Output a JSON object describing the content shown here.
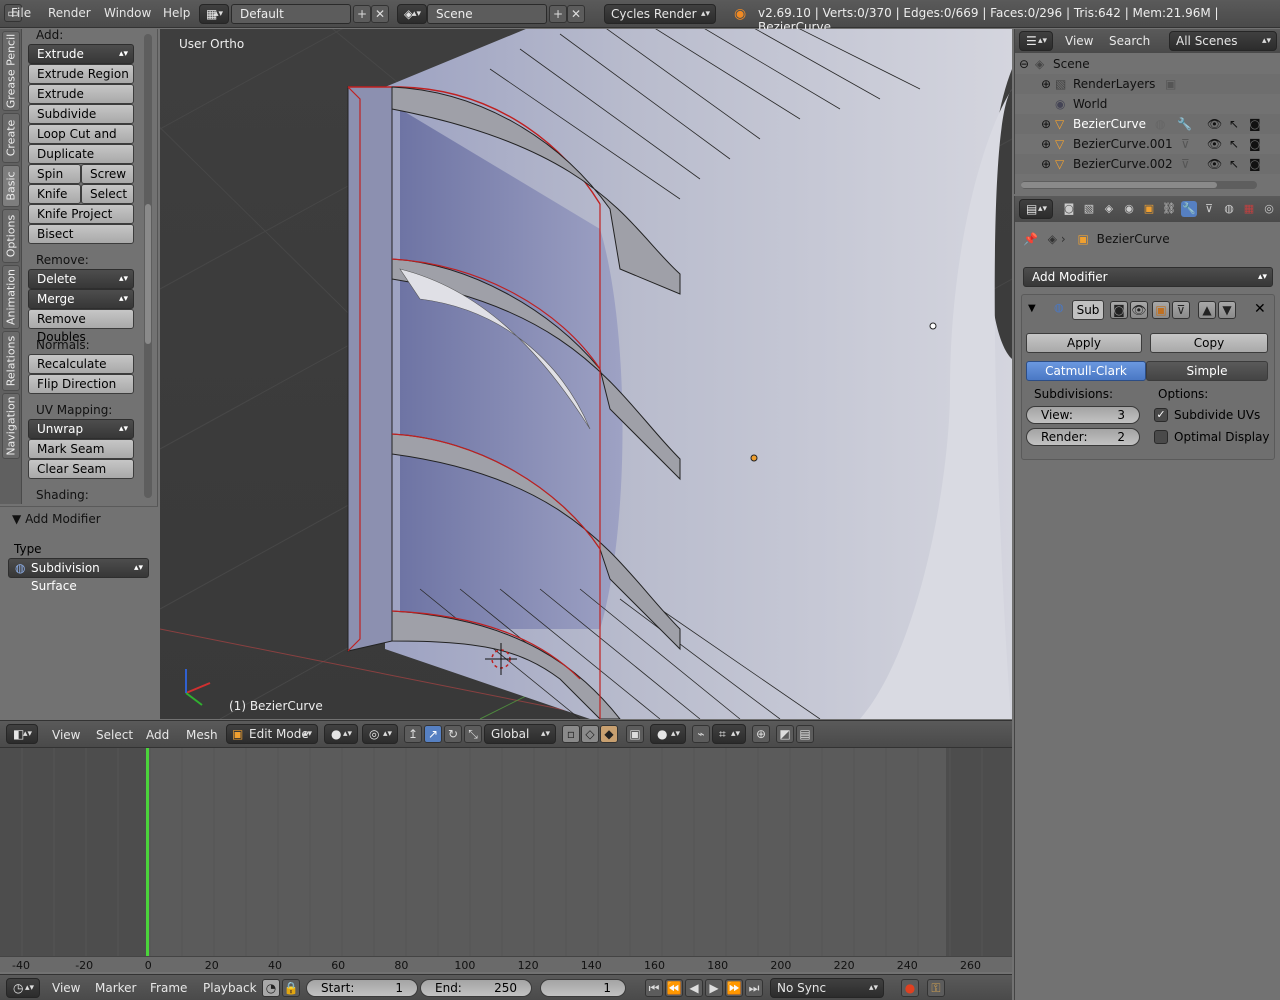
{
  "topbar": {
    "menus": [
      "File",
      "Render",
      "Window",
      "Help"
    ],
    "layout": "Default",
    "scene": "Scene",
    "engine": "Cycles Render",
    "stats": "v2.69.10 | Verts:0/370 | Edges:0/669 | Faces:0/296 | Tris:642 | Mem:21.96M | BezierCurve"
  },
  "tabs": [
    "Grease Pencil",
    "Create",
    "Basic",
    "Options",
    "Animation",
    "Relations",
    "Navigation"
  ],
  "toolshelf": {
    "add_label": "Add:",
    "extrude": "Extrude",
    "extrude_region": "Extrude Region",
    "extrude_individual": "Extrude Individual",
    "subdivide": "Subdivide",
    "loop_cut": "Loop Cut and Slide",
    "duplicate": "Duplicate",
    "spin": "Spin",
    "screw": "Screw",
    "knife": "Knife",
    "select": "Select",
    "knife_project": "Knife Project",
    "bisect": "Bisect",
    "remove_label": "Remove:",
    "delete": "Delete",
    "merge": "Merge",
    "remove_doubles": "Remove Doubles",
    "normals_label": "Normals:",
    "recalculate": "Recalculate",
    "flip_direction": "Flip Direction",
    "uv_label": "UV Mapping:",
    "unwrap": "Unwrap",
    "mark_seam": "Mark Seam",
    "clear_seam": "Clear Seam",
    "shading_label": "Shading:"
  },
  "operator": {
    "title": "Add Modifier",
    "type_label": "Type",
    "type_value": "Subdivision Surface"
  },
  "viewport": {
    "view_name": "User Ortho",
    "object_name": "(1) BezierCurve"
  },
  "view3d_header": {
    "view": "View",
    "select": "Select",
    "add": "Add",
    "mesh": "Mesh",
    "mode": "Edit Mode",
    "orientation": "Global"
  },
  "ruler": [
    "-40",
    "-20",
    "0",
    "20",
    "40",
    "60",
    "80",
    "100",
    "120",
    "140",
    "160",
    "180",
    "200",
    "220",
    "240",
    "260"
  ],
  "timeline_header": {
    "view": "View",
    "marker": "Marker",
    "frame": "Frame",
    "playback": "Playback",
    "start_label": "Start:",
    "start": "1",
    "end_label": "End:",
    "end": "250",
    "current": "1",
    "sync": "No Sync"
  },
  "outliner": {
    "view": "View",
    "search": "Search",
    "filter": "All Scenes",
    "items": [
      "Scene",
      "RenderLayers",
      "World",
      "BezierCurve",
      "BezierCurve.001",
      "BezierCurve.002"
    ]
  },
  "properties": {
    "breadcrumb": "BezierCurve",
    "add_modifier": "Add Modifier",
    "modifier_name": "Sub",
    "apply": "Apply",
    "copy": "Copy",
    "catmull": "Catmull-Clark",
    "simple": "Simple",
    "subdivisions_label": "Subdivisions:",
    "options_label": "Options:",
    "view_label": "View:",
    "view_value": "3",
    "render_label": "Render:",
    "render_value": "2",
    "subdivide_uvs": "Subdivide UVs",
    "optimal_display": "Optimal Display"
  },
  "colors": {
    "selected_blue": "#5680c2",
    "playhead": "#4bd43b",
    "active_orange": "#f0a030"
  }
}
